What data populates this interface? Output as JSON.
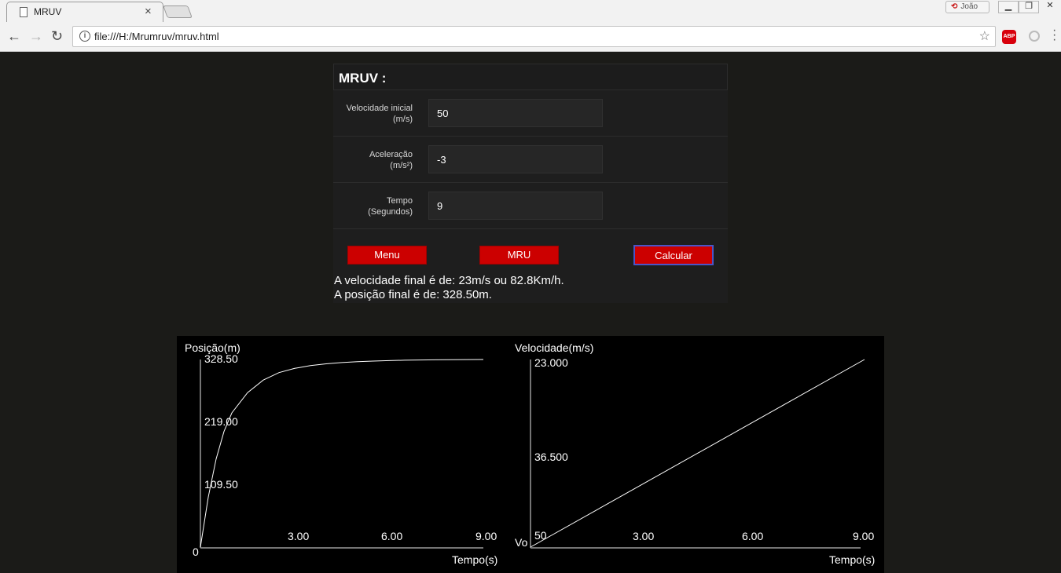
{
  "browser": {
    "tab_title": "MRUV",
    "tab_close": "×",
    "user_name": "João",
    "url": "file:///H:/Mrumruv/mruv.html",
    "extension_abp": "ABP"
  },
  "form": {
    "title": "MRUV :",
    "fields": [
      {
        "label_line1": "Velocidade inicial",
        "label_line2": "(m/s)",
        "value": "50"
      },
      {
        "label_line1": "Aceleração",
        "label_line2": "(m/s²)",
        "value": "-3"
      },
      {
        "label_line1": "Tempo",
        "label_line2": "(Segundos)",
        "value": "9"
      }
    ],
    "buttons": {
      "menu": "Menu",
      "mru": "MRU",
      "calcular": "Calcular"
    },
    "results": [
      "A velocidade final é de: 23m/s ou 82.8Km/h.",
      "A posição final é de: 328.50m."
    ]
  },
  "chart_data": [
    {
      "type": "line",
      "title": "",
      "ylabel": "Posição(m)",
      "xlabel": "Tempo(s)",
      "origin_label": "0",
      "y_ticks": [
        "109.50",
        "219.00",
        "328.50"
      ],
      "x_ticks": [
        "3.00",
        "6.00",
        "9.00"
      ],
      "xlim": [
        0,
        9
      ],
      "ylim": [
        0,
        328.5
      ],
      "series": [
        {
          "x": [
            0,
            0.25,
            0.5,
            0.75,
            1,
            1.5,
            2,
            2.5,
            3,
            3.5,
            4,
            4.5,
            5,
            5.5,
            6,
            6.5,
            7,
            7.5,
            8,
            8.5,
            9
          ],
          "y": [
            0,
            87.5,
            154.3,
            202.5,
            235,
            270.5,
            292.5,
            305.5,
            313,
            317.8,
            321,
            323.2,
            324.7,
            325.8,
            326.6,
            327.2,
            327.7,
            328,
            328.2,
            328.4,
            328.5
          ]
        }
      ],
      "colors": {
        "line": "#ffffff",
        "axis": "#9a9a9a",
        "background": "#000000"
      }
    },
    {
      "type": "line",
      "title": "",
      "ylabel": "Velocidade(m/s)",
      "xlabel": "Tempo(s)",
      "origin_label": "Vo",
      "y_ticks": [
        "50",
        "36.500",
        "23.000"
      ],
      "x_ticks": [
        "3.00",
        "6.00",
        "9.00"
      ],
      "xlim": [
        0,
        9
      ],
      "series": [
        {
          "x": [
            0,
            9
          ],
          "y": [
            50,
            23
          ]
        }
      ],
      "colors": {
        "line": "#ffffff",
        "axis": "#9a9a9a",
        "background": "#000000"
      }
    }
  ]
}
